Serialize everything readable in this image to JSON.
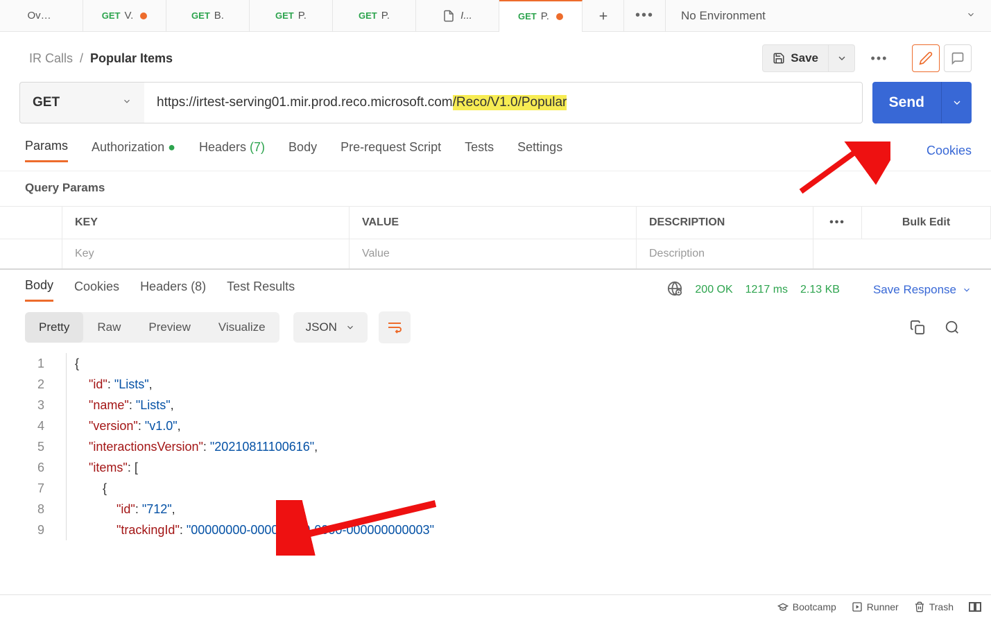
{
  "tabs": {
    "items": [
      {
        "method": "",
        "label": "Over...",
        "dot": false,
        "fileIcon": false
      },
      {
        "method": "GET",
        "label": "V.",
        "dot": true,
        "fileIcon": false
      },
      {
        "method": "GET",
        "label": "B.",
        "dot": false,
        "fileIcon": false
      },
      {
        "method": "GET",
        "label": "P.",
        "dot": false,
        "fileIcon": false
      },
      {
        "method": "GET",
        "label": "P.",
        "dot": false,
        "fileIcon": false
      },
      {
        "method": "",
        "label": "I...",
        "dot": false,
        "fileIcon": true
      },
      {
        "method": "GET",
        "label": "P.",
        "dot": true,
        "fileIcon": false,
        "active": true
      }
    ],
    "env": "No Environment"
  },
  "breadcrumb": {
    "collection": "IR Calls",
    "current": "Popular Items"
  },
  "actions": {
    "save_label": "Save"
  },
  "request": {
    "method": "GET",
    "url_prefix": "https://irtest-serving01.mir.prod.reco.microsoft.com",
    "url_highlight": "/Reco/V1.0/Popular",
    "send_label": "Send",
    "tabs": [
      {
        "label": "Params",
        "active": true
      },
      {
        "label": "Authorization",
        "green": true
      },
      {
        "label": "Headers",
        "count": "(7)"
      },
      {
        "label": "Body"
      },
      {
        "label": "Pre-request Script"
      },
      {
        "label": "Tests"
      },
      {
        "label": "Settings"
      }
    ],
    "cookies_label": "Cookies",
    "qp_title": "Query Params",
    "table_headers": {
      "key": "KEY",
      "value": "VALUE",
      "desc": "DESCRIPTION",
      "bulk": "Bulk Edit"
    },
    "placeholders": {
      "key": "Key",
      "value": "Value",
      "desc": "Description"
    }
  },
  "response": {
    "tabs": [
      {
        "label": "Body",
        "active": true
      },
      {
        "label": "Cookies"
      },
      {
        "label": "Headers",
        "count": "(8)"
      },
      {
        "label": "Test Results"
      }
    ],
    "status": "200 OK",
    "time": "1217 ms",
    "size": "2.13 KB",
    "save_label": "Save Response",
    "format_pills": [
      "Pretty",
      "Raw",
      "Preview",
      "Visualize"
    ],
    "json_label": "JSON",
    "body_lines": [
      {
        "n": 1,
        "indent": 0,
        "raw": "{"
      },
      {
        "n": 2,
        "indent": 1,
        "key": "\"id\"",
        "val": "\"Lists\"",
        "trail": ","
      },
      {
        "n": 3,
        "indent": 1,
        "key": "\"name\"",
        "val": "\"Lists\"",
        "trail": ","
      },
      {
        "n": 4,
        "indent": 1,
        "key": "\"version\"",
        "val": "\"v1.0\"",
        "trail": ","
      },
      {
        "n": 5,
        "indent": 1,
        "key": "\"interactionsVersion\"",
        "val": "\"20210811100616\"",
        "trail": ","
      },
      {
        "n": 6,
        "indent": 1,
        "key": "\"items\"",
        "raw2": ": ["
      },
      {
        "n": 7,
        "indent": 2,
        "raw": "{"
      },
      {
        "n": 8,
        "indent": 3,
        "key": "\"id\"",
        "val": "\"712\"",
        "trail": ","
      },
      {
        "n": 9,
        "indent": 3,
        "key": "\"trackingId\"",
        "val": "\"00000000-0000-0000-0000-000000000003\""
      }
    ]
  },
  "statusbar": {
    "bootcamp": "Bootcamp",
    "runner": "Runner",
    "trash": "Trash"
  }
}
